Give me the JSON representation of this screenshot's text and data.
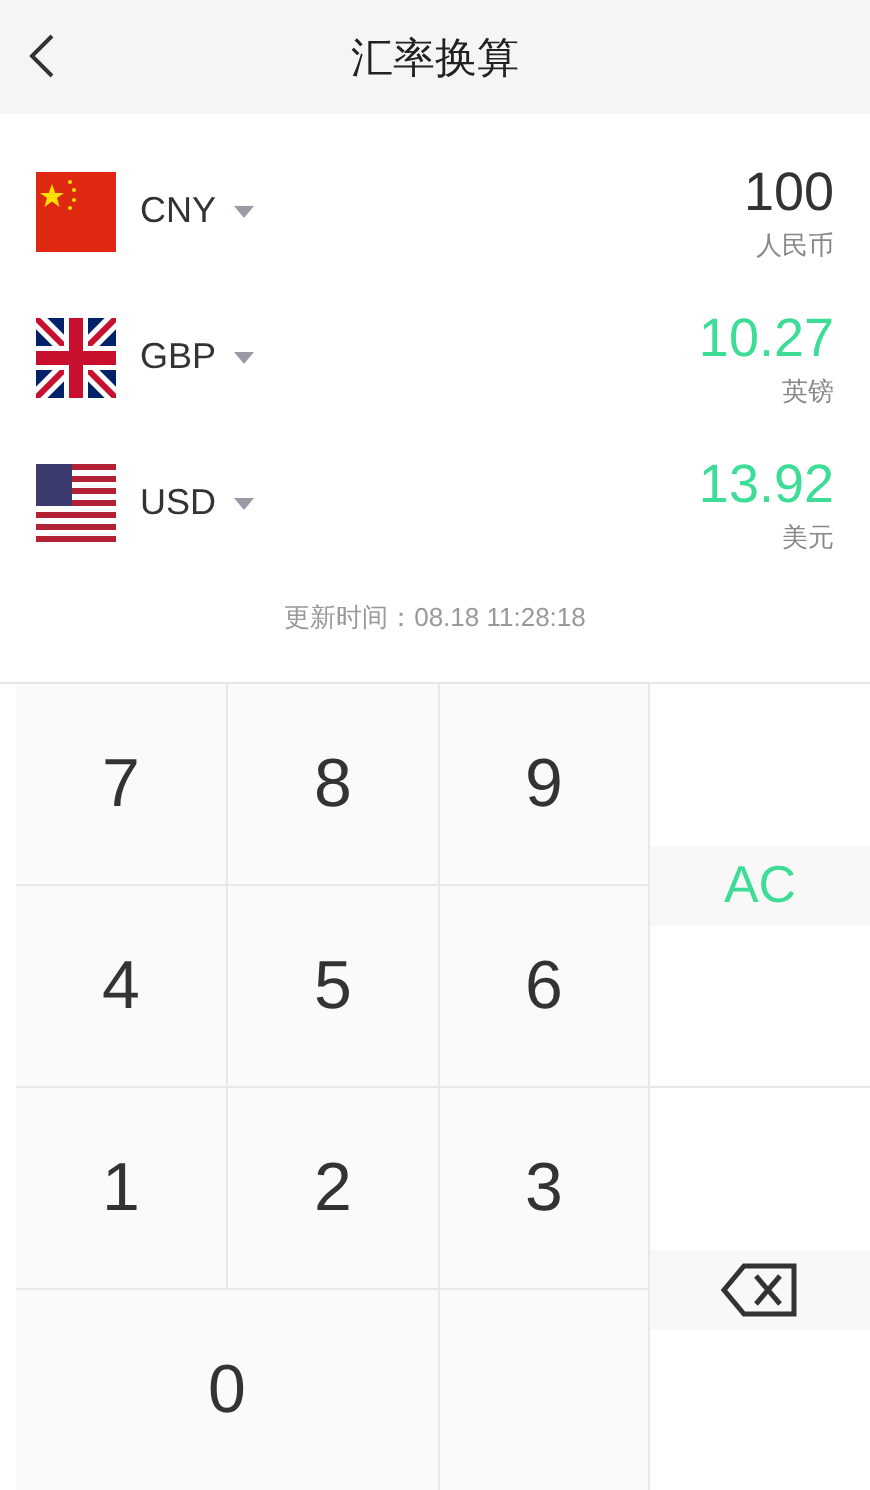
{
  "header": {
    "title": "汇率换算"
  },
  "currencies": [
    {
      "code": "CNY",
      "amount": "100",
      "name": "人民币",
      "kind": "base"
    },
    {
      "code": "GBP",
      "amount": "10.27",
      "name": "英镑",
      "kind": "converted"
    },
    {
      "code": "USD",
      "amount": "13.92",
      "name": "美元",
      "kind": "converted"
    }
  ],
  "updated": "更新时间：08.18 11:28:18",
  "keys": [
    {
      "kind": "digit",
      "label": "7"
    },
    {
      "kind": "digit",
      "label": "8"
    },
    {
      "kind": "digit",
      "label": "9"
    },
    {
      "kind": "clear",
      "label": "AC"
    },
    {
      "kind": "digit",
      "label": "4"
    },
    {
      "kind": "digit",
      "label": "5"
    },
    {
      "kind": "digit",
      "label": "6"
    },
    {
      "kind": "digit",
      "label": "1"
    },
    {
      "kind": "digit",
      "label": "2"
    },
    {
      "kind": "digit",
      "label": "3"
    },
    {
      "kind": "backspace"
    },
    {
      "kind": "wide_digit",
      "label": "0"
    },
    {
      "kind": "blank"
    }
  ]
}
